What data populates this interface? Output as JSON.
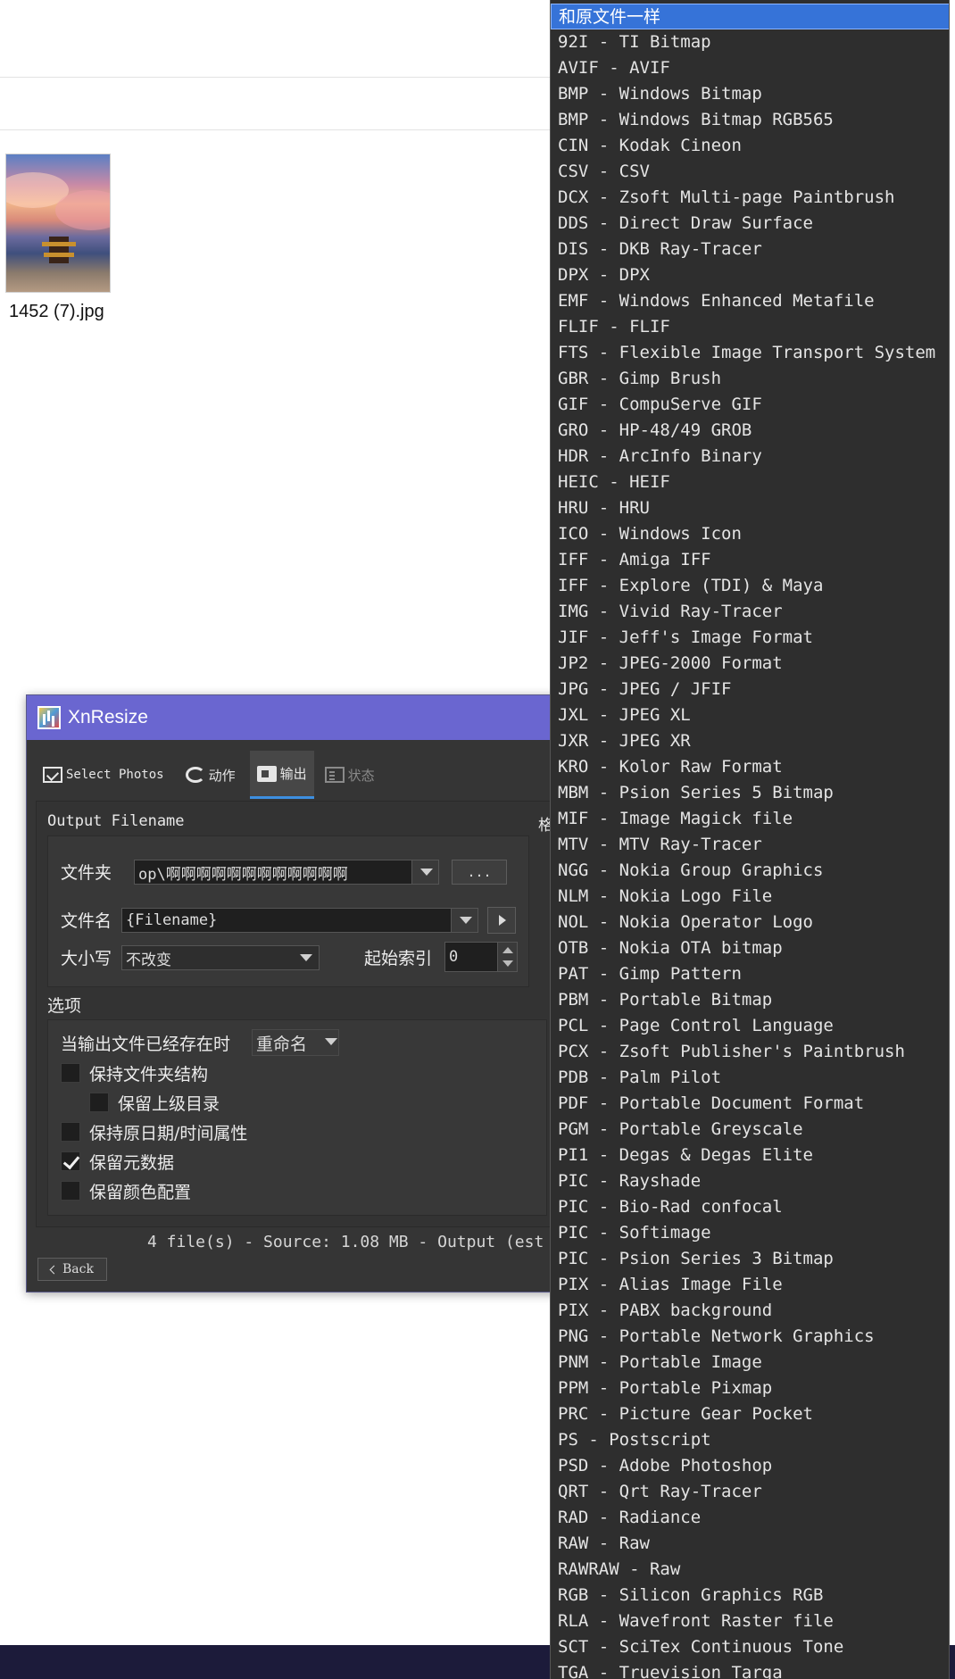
{
  "explorer": {
    "thumbnail_label": "1452 (7).jpg"
  },
  "window": {
    "title": "XnResize",
    "tabs": [
      {
        "label": "Select Photos"
      },
      {
        "label": "动作"
      },
      {
        "label": "输出"
      },
      {
        "label": "状态"
      }
    ],
    "output_filename": {
      "section_label": "Output Filename",
      "folder_label": "文件夹",
      "folder_value": "op\\啊啊啊啊啊啊啊啊啊啊啊啊",
      "browse_label": "...",
      "filename_label": "文件名",
      "filename_value": "{Filename}",
      "case_label": "大小写",
      "case_value": "不改变",
      "start_index_label": "起始索引",
      "start_index_value": "0"
    },
    "format_label_partial": "格",
    "options": {
      "section_label": "选项",
      "exists_label": "当输出文件已经存在时",
      "exists_value": "重命名",
      "keep_folder_structure": "保持文件夹结构",
      "keep_parent_dir": "保留上级目录",
      "keep_datetime": "保持原日期/时间属性",
      "keep_metadata": "保留元数据",
      "keep_color_profile": "保留颜色配置"
    },
    "status_text": "4 file(s) - Source: 1.08 MB - Output (est",
    "back_label": "Back"
  },
  "format_dropdown": {
    "items": [
      "和原文件一样",
      "92I - TI Bitmap",
      "AVIF - AVIF",
      "BMP - Windows Bitmap",
      "BMP - Windows Bitmap RGB565",
      "CIN - Kodak Cineon",
      "CSV - CSV",
      "DCX - Zsoft Multi-page Paintbrush",
      "DDS - Direct Draw Surface",
      "DIS - DKB Ray-Tracer",
      "DPX - DPX",
      "EMF - Windows Enhanced Metafile",
      "FLIF - FLIF",
      "FTS - Flexible Image Transport System",
      "GBR - Gimp Brush",
      "GIF - CompuServe GIF",
      "GRO - HP-48/49 GROB",
      "HDR - ArcInfo Binary",
      "HEIC - HEIF",
      "HRU - HRU",
      "ICO - Windows Icon",
      "IFF - Amiga IFF",
      "IFF - Explore (TDI) & Maya",
      "IMG - Vivid Ray-Tracer",
      "JIF - Jeff's Image Format",
      "JP2 - JPEG-2000 Format",
      "JPG - JPEG / JFIF",
      "JXL - JPEG XL",
      "JXR - JPEG XR",
      "KRO - Kolor Raw Format",
      "MBM - Psion Series 5 Bitmap",
      "MIF - Image Magick file",
      "MTV - MTV Ray-Tracer",
      "NGG - Nokia Group Graphics",
      "NLM - Nokia Logo File",
      "NOL - Nokia Operator Logo",
      "OTB - Nokia OTA bitmap",
      "PAT - Gimp Pattern",
      "PBM - Portable Bitmap",
      "PCL - Page Control Language",
      "PCX - Zsoft Publisher's Paintbrush",
      "PDB - Palm Pilot",
      "PDF - Portable Document Format",
      "PGM - Portable Greyscale",
      "PI1 - Degas & Degas Elite",
      "PIC - Rayshade",
      "PIC - Bio-Rad confocal",
      "PIC - Softimage",
      "PIC - Psion Series 3 Bitmap",
      "PIX - Alias Image File",
      "PIX - PABX background",
      "PNG - Portable Network Graphics",
      "PNM - Portable Image",
      "PPM - Portable Pixmap",
      "PRC - Picture Gear Pocket",
      "PS - Postscript",
      "PSD - Adobe Photoshop",
      "QRT - Qrt Ray-Tracer",
      "RAD - Radiance",
      "RAW - Raw",
      "RAWRAW - Raw",
      "RGB - Silicon Graphics RGB",
      "RLA - Wavefront Raster file",
      "SCT - SciTex Continuous Tone",
      "TGA - Truevision Targa"
    ]
  }
}
